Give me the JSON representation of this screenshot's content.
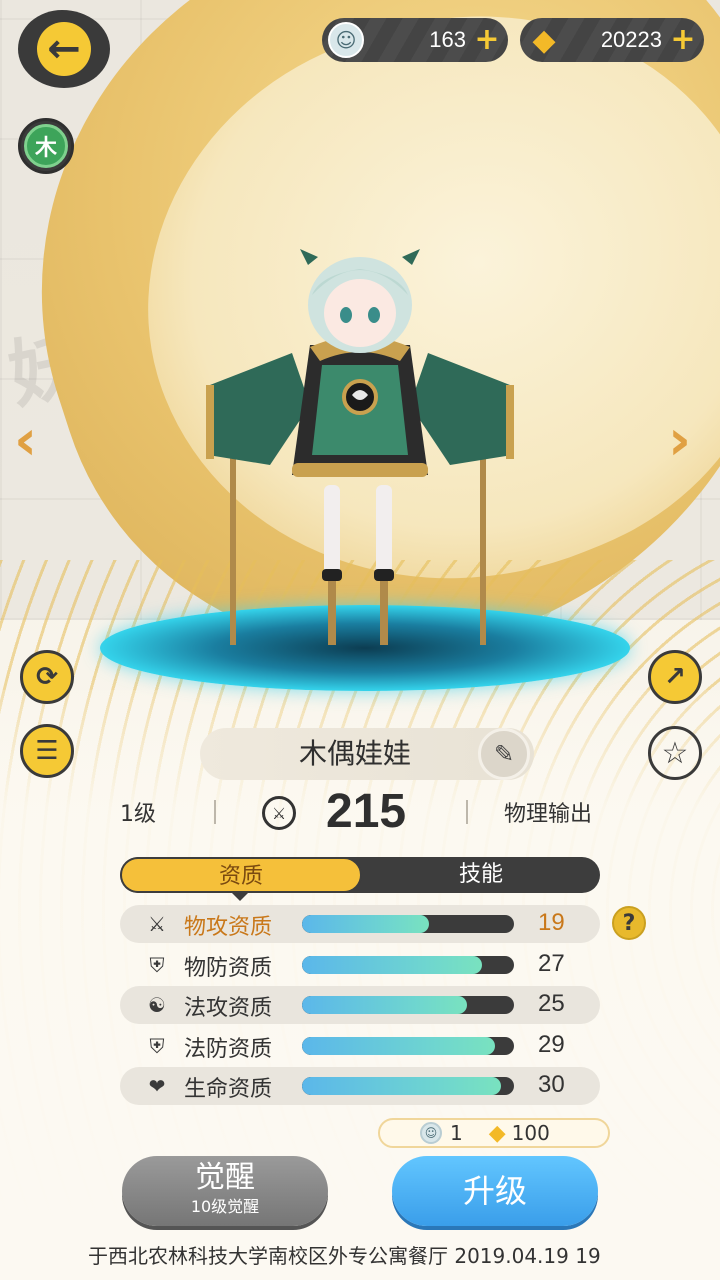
{
  "currencies": [
    {
      "icon": "doll-icon",
      "value": "163"
    },
    {
      "icon": "gold-crystal-icon",
      "value": "20223"
    }
  ],
  "element_badge": "木",
  "character": {
    "name": "木偶娃娃",
    "level": "1级",
    "power": "215",
    "type": "物理输出"
  },
  "tabs": [
    {
      "label": "资质",
      "active": true
    },
    {
      "label": "技能",
      "active": false
    }
  ],
  "stats": [
    {
      "icon": "crossed-swords-icon",
      "label": "物攻资质",
      "value": "19",
      "highlight": true,
      "fill": 0.6
    },
    {
      "icon": "shield-icon",
      "label": "物防资质",
      "value": "27",
      "highlight": false,
      "fill": 0.85
    },
    {
      "icon": "magic-orb-icon",
      "label": "法攻资质",
      "value": "25",
      "highlight": false,
      "fill": 0.78
    },
    {
      "icon": "shield-icon",
      "label": "法防资质",
      "value": "29",
      "highlight": false,
      "fill": 0.91
    },
    {
      "icon": "heart-icon",
      "label": "生命资质",
      "value": "30",
      "highlight": false,
      "fill": 0.94
    }
  ],
  "cost": {
    "doll": "1",
    "gold": "100"
  },
  "buttons": {
    "awaken": "觉醒",
    "awaken_sub": "10级觉醒",
    "upgrade": "升级"
  },
  "footer": "于西北农林科技大学南校区外专公寓餐厅  2019.04.19  19",
  "colors": {
    "accent": "#f5c935",
    "dark": "#3a3a3a",
    "highlight": "#c9781a",
    "upgrade_blue": "#3a9eea",
    "bar_fill": "#6fd6cf"
  }
}
